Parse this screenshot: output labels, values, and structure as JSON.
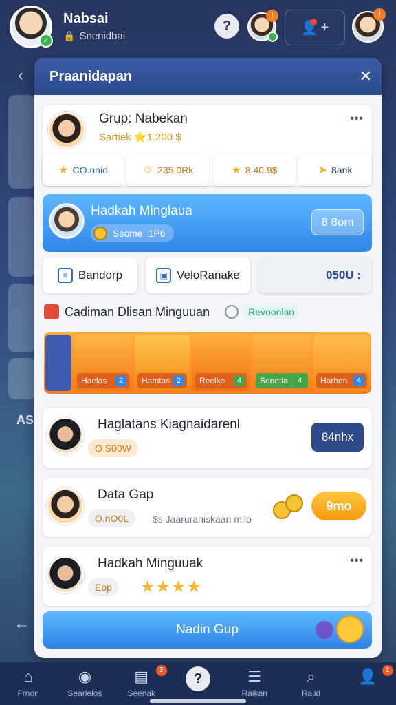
{
  "header": {
    "user_name": "Nabsai",
    "user_status": "Snenidbai",
    "help_icon_label": "?",
    "notif_badge": "!",
    "profile_badge": "!"
  },
  "modal": {
    "title": "Praanidapan",
    "group": {
      "name": "Grup: Nabekan",
      "subtitle": "Sartiek ⭐1.200 $",
      "stats": [
        {
          "icon": "star-icon",
          "label": "CO.nnio"
        },
        {
          "icon": "smile-coin-icon",
          "label": "235.0Rk"
        },
        {
          "icon": "star-icon",
          "label": "8.40.9$"
        },
        {
          "icon": "send-icon",
          "label": "8ank"
        }
      ]
    },
    "weekly": {
      "title": "Hadkah Minglaua",
      "points": "Ssome",
      "unit": "1P6",
      "action": "8 8om"
    },
    "actions": {
      "broadcast": "Bandorp",
      "box": "VeloRanake",
      "amount": "050U :"
    },
    "section": {
      "title": "Cadiman Dlisan Minguuan",
      "link": "Revoonlan"
    },
    "rewards": [
      {
        "label": "Haelas",
        "num": "2"
      },
      {
        "label": "Hamtas",
        "num": "2"
      },
      {
        "label": "Reelke",
        "num": "4"
      },
      {
        "label": "Senetia",
        "num": "4"
      },
      {
        "label": "Harhen",
        "num": "4"
      }
    ],
    "members": [
      {
        "name": "Haglatans Kiagnaidarenl",
        "chip": "O S00W",
        "action": "84nhx"
      },
      {
        "name": "Data Gap",
        "chip": "O.nO0L",
        "note": "$s Jaaruraniskaan mllo",
        "action": "9mo"
      },
      {
        "name": "Hadkah Minguuak",
        "chip": "Eop"
      }
    ],
    "join_button": "Nadin Gup"
  },
  "side": {
    "text": "AS"
  },
  "bottom_nav": [
    {
      "icon": "home-icon",
      "label": "Frnon",
      "badge": ""
    },
    {
      "icon": "globe-icon",
      "label": "Searlelos",
      "badge": ""
    },
    {
      "icon": "store-icon",
      "label": "Seenak",
      "badge": "3"
    },
    {
      "icon": "help-icon",
      "label": "",
      "badge": ""
    },
    {
      "icon": "list-icon",
      "label": "Raikan",
      "badge": ""
    },
    {
      "icon": "search-icon",
      "label": "Rajid",
      "badge": ""
    },
    {
      "icon": "profile-icon",
      "label": "",
      "badge": "1"
    }
  ]
}
